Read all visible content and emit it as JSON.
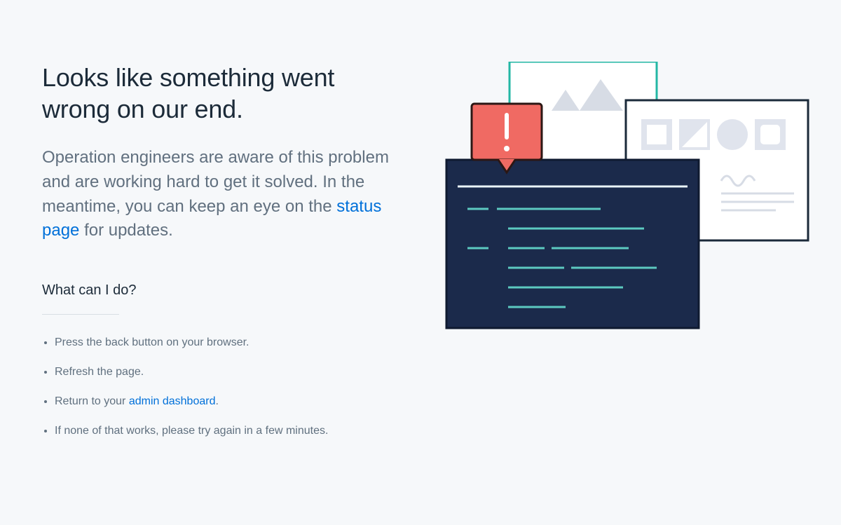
{
  "heading": "Looks like something went wrong on our end.",
  "lede_before": "Operation engineers are aware of this problem and are working hard to get it solved. In the meantime, you can keep an eye on the ",
  "lede_link": "status page",
  "lede_after": " for updates.",
  "sub_heading": "What can I do?",
  "tips": [
    "Press the back button on your browser.",
    "Refresh the page."
  ],
  "tip3_before": "Return to your ",
  "tip3_link": "admin dashboard",
  "tip3_after": ".",
  "tip4": "If none of that works, please try again in a few minutes."
}
